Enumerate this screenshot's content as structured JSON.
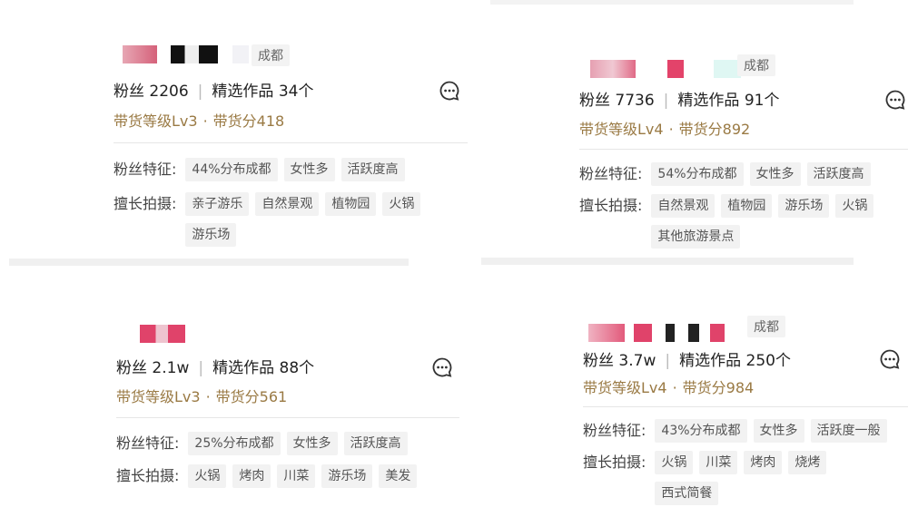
{
  "cards": [
    {
      "city": "成都",
      "fans_label": "粉丝",
      "fans": "2206",
      "works_label": "精选作品",
      "works": "34个",
      "level": "带货等级Lv3",
      "score": "带货分418",
      "features_label": "粉丝特征:",
      "features": [
        "44%分布成都",
        "女性多",
        "活跃度高"
      ],
      "skills_label": "擅长拍摄:",
      "skills": [
        "亲子游乐",
        "自然景观",
        "植物园",
        "火锅",
        "游乐场"
      ]
    },
    {
      "city": "成都",
      "fans_label": "粉丝",
      "fans": "7736",
      "works_label": "精选作品",
      "works": "91个",
      "level": "带货等级Lv4",
      "score": "带货分892",
      "features_label": "粉丝特征:",
      "features": [
        "54%分布成都",
        "女性多",
        "活跃度高"
      ],
      "skills_label": "擅长拍摄:",
      "skills": [
        "自然景观",
        "植物园",
        "游乐场",
        "火锅",
        "其他旅游景点"
      ]
    },
    {
      "fans_label": "粉丝",
      "fans": "2.1w",
      "works_label": "精选作品",
      "works": "88个",
      "level": "带货等级Lv3",
      "score": "带货分561",
      "features_label": "粉丝特征:",
      "features": [
        "25%分布成都",
        "女性多",
        "活跃度高"
      ],
      "skills_label": "擅长拍摄:",
      "skills": [
        "火锅",
        "烤肉",
        "川菜",
        "游乐场",
        "美发"
      ]
    },
    {
      "city": "成都",
      "fans_label": "粉丝",
      "fans": "3.7w",
      "works_label": "精选作品",
      "works": "250个",
      "level": "带货等级Lv4",
      "score": "带货分984",
      "features_label": "粉丝特征:",
      "features": [
        "43%分布成都",
        "女性多",
        "活跃度一般"
      ],
      "skills_label": "擅长拍摄:",
      "skills": [
        "火锅",
        "川菜",
        "烤肉",
        "烧烤",
        "西式简餐"
      ]
    }
  ],
  "colors": {
    "accent_gold": "#9a7a44",
    "tag_bg": "#f2f2f2"
  },
  "icons": {
    "message": "chat-bubble-icon"
  }
}
